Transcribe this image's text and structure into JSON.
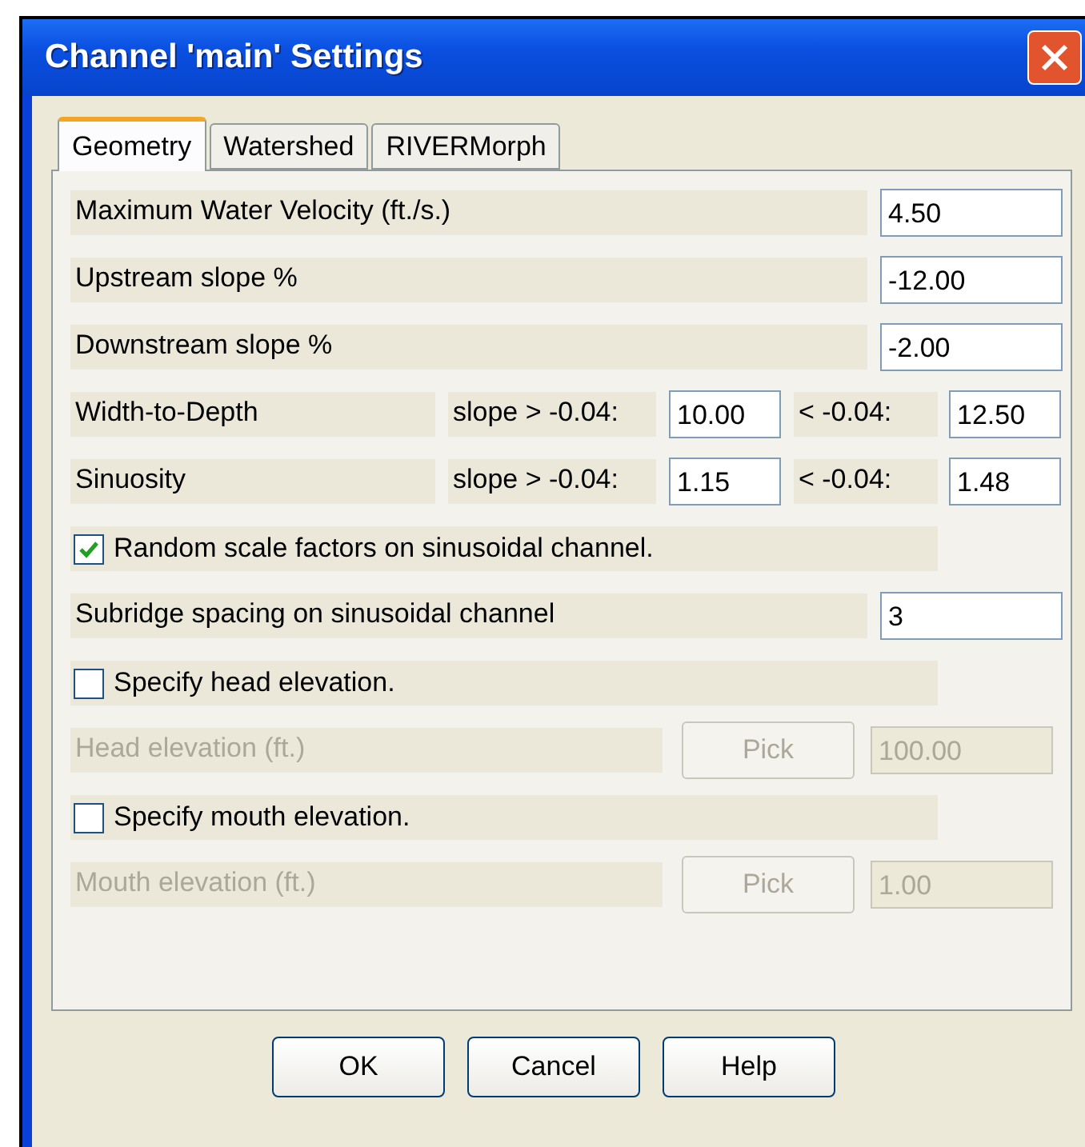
{
  "window": {
    "title": "Channel 'main' Settings"
  },
  "tabs": [
    {
      "label": "Geometry",
      "selected": true
    },
    {
      "label": "Watershed",
      "selected": false
    },
    {
      "label": "RIVERMorph",
      "selected": false
    }
  ],
  "rows": [
    {
      "kind": "field",
      "label": "Maximum Water Velocity (ft./s.)",
      "value": "4.50"
    },
    {
      "kind": "field",
      "label": "Upstream slope %",
      "value": "-12.00"
    },
    {
      "kind": "field",
      "label": "Downstream slope %",
      "value": "-2.00"
    },
    {
      "kind": "pair",
      "label": "Width-to-Depth",
      "left_label": "slope > -0.04:",
      "left_value": "10.00",
      "right_label": "< -0.04:",
      "right_value": "12.50"
    },
    {
      "kind": "pair",
      "label": "Sinuosity",
      "left_label": "slope > -0.04:",
      "left_value": "1.15",
      "right_label": "< -0.04:",
      "right_value": "1.48"
    },
    {
      "kind": "checkbox",
      "label": "Random scale factors on sinusoidal channel.",
      "checked": true
    },
    {
      "kind": "field",
      "label": "Subridge spacing on sinusoidal channel",
      "value": "3"
    },
    {
      "kind": "checkbox",
      "label": "Specify head elevation.",
      "checked": false
    },
    {
      "kind": "pick",
      "label": "Head elevation (ft.)",
      "button": "Pick",
      "value": "100.00",
      "disabled": true
    },
    {
      "kind": "checkbox",
      "label": "Specify mouth elevation.",
      "checked": false
    },
    {
      "kind": "pick",
      "label": "Mouth elevation (ft.)",
      "button": "Pick",
      "value": "1.00",
      "disabled": true
    }
  ],
  "buttons": [
    "OK",
    "Cancel",
    "Help"
  ]
}
